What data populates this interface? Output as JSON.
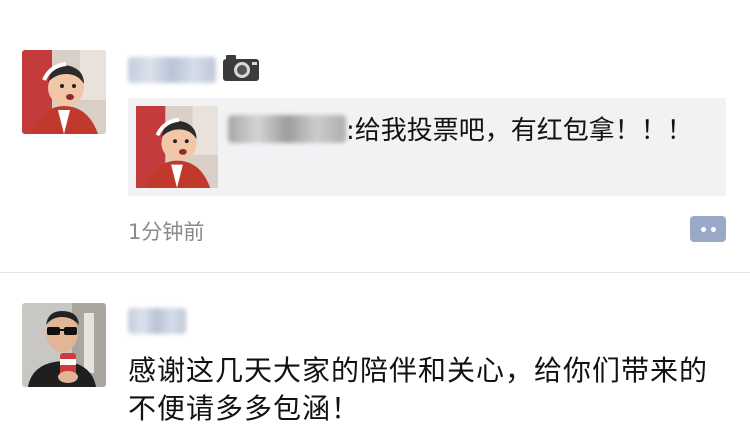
{
  "post1": {
    "author_name": "",
    "camera_icon": "camera-icon",
    "shared_prefix": ":给我投票吧，有红包拿！！！",
    "time": "1分钟前",
    "comment_icon": "comment-dots-icon"
  },
  "post2": {
    "author_name": "",
    "text": "感谢这几天大家的陪伴和关心，给你们带来的不便请多多包涵！"
  },
  "colors": {
    "accent_name": "#576b95",
    "card_bg": "#f2f2f5",
    "time_text": "#8a8a8a"
  }
}
